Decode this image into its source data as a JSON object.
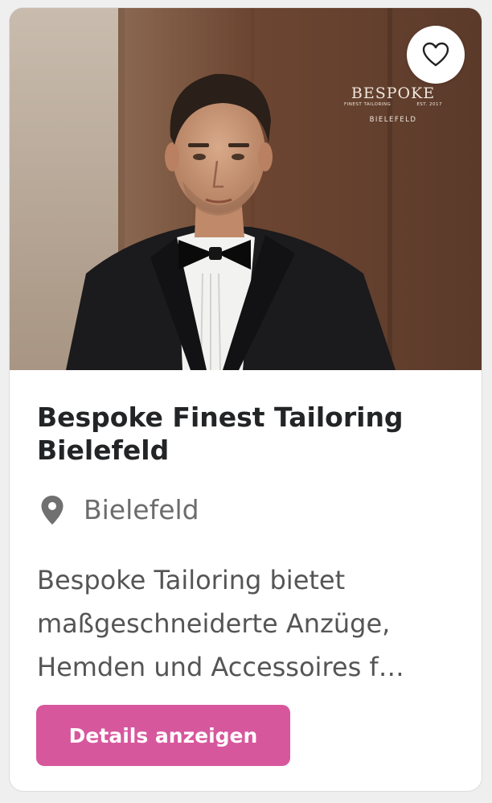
{
  "listing": {
    "title": "Bespoke Finest Tailoring Bielefeld",
    "location": "Bielefeld",
    "description": "Bespoke Tailoring bietet maßgeschneiderte Anzüge, Hemden und Accessoires f…",
    "details_label": "Details anzeigen"
  },
  "logo": {
    "name": "BESPOKE",
    "tagline": "FINEST TAILORING",
    "established": "EST. 2017",
    "city": "BIELEFELD"
  },
  "icons": {
    "favorite": "heart-outline-icon",
    "location": "map-pin-icon"
  },
  "colors": {
    "button": "#d7579d",
    "title": "#222426",
    "location_text": "#6c6c6c",
    "description_text": "#555555"
  }
}
